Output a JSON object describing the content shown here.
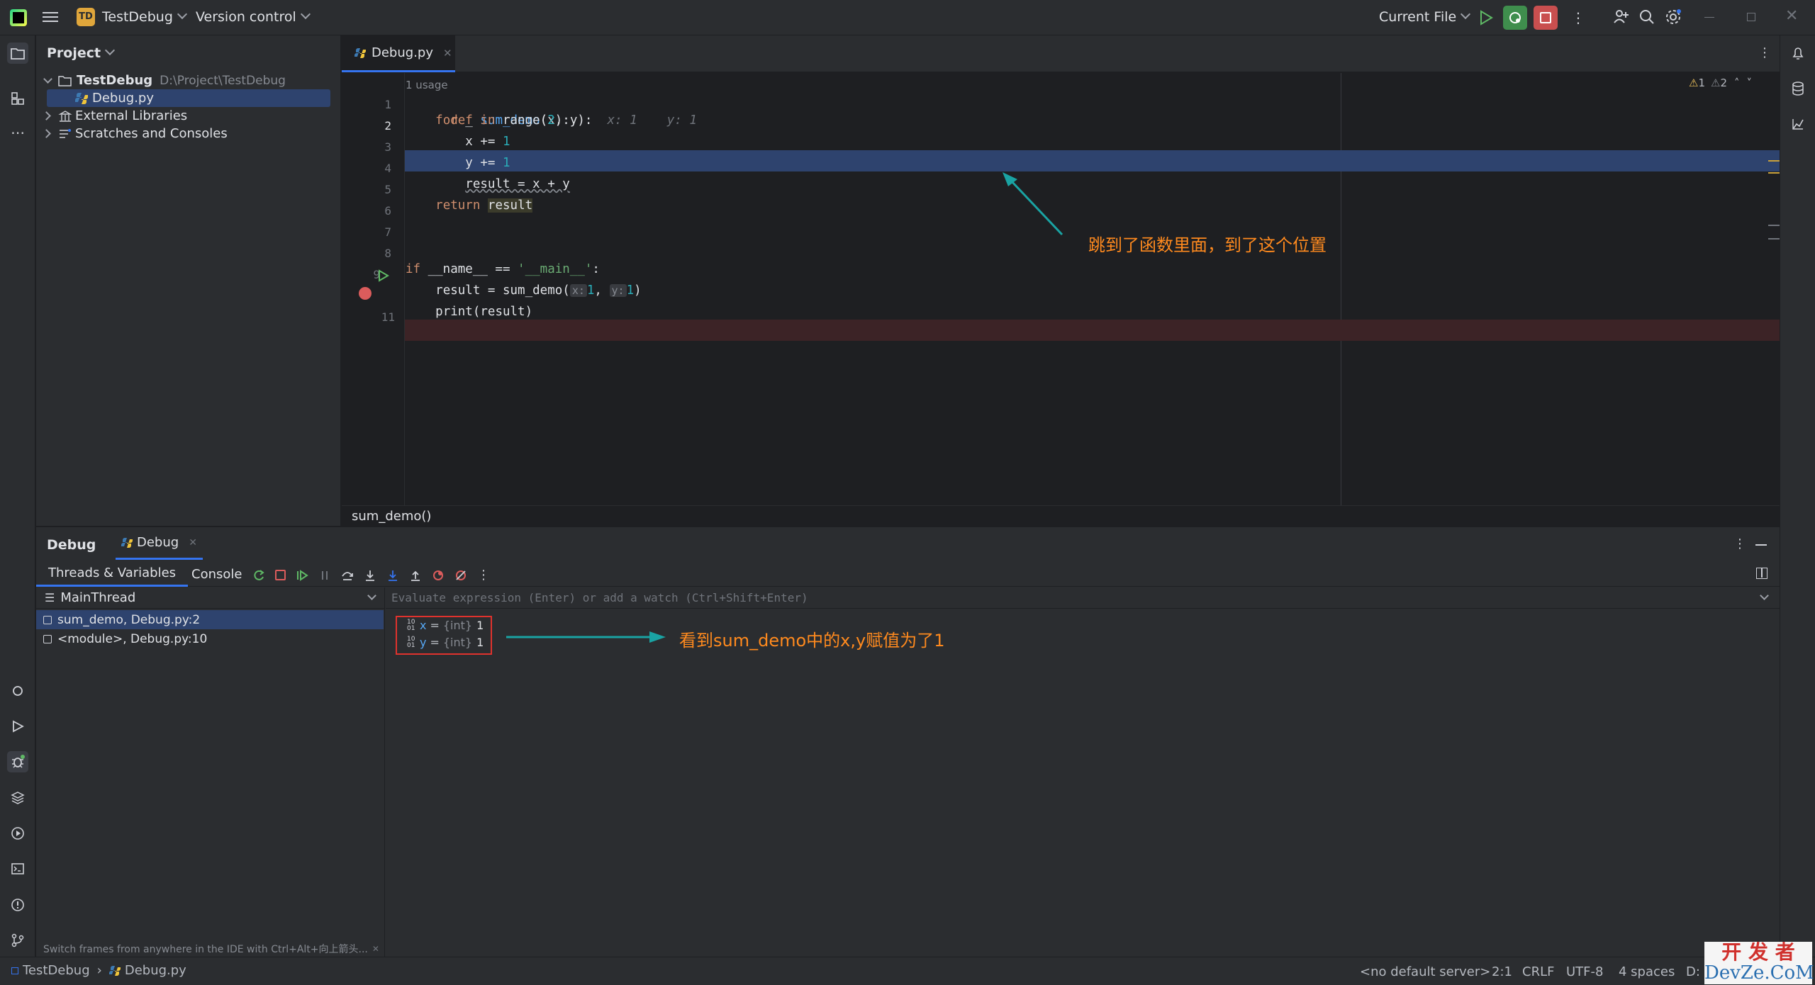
{
  "titlebar": {
    "project_badge": "TD",
    "project_name": "TestDebug",
    "vcs_label": "Version control",
    "run_config": "Current File"
  },
  "project_panel": {
    "title": "Project",
    "root_name": "TestDebug",
    "root_path": "D:\\Project\\TestDebug",
    "items": [
      {
        "label": "Debug.py"
      },
      {
        "label": "External Libraries"
      },
      {
        "label": "Scratches and Consoles"
      }
    ]
  },
  "editor": {
    "tab_label": "Debug.py",
    "usage_hint": "1 usage",
    "warnings": "1",
    "weak_warnings": "2",
    "breadcrumb": "sum_demo()",
    "lines": {
      "l1_def": "def ",
      "l1_fn": "sum_demo",
      "l1_rest": "(x, y):",
      "l1_hint": "x: 1    y: 1",
      "l2_for": "for",
      "l2_mid": " _ ",
      "l2_in": "in",
      "l2_range": " range(",
      "l2_num": "2",
      "l2_end": "):",
      "l3": "x += ",
      "l3_num": "1",
      "l4": "y += ",
      "l4_num": "1",
      "l5": "result = x + y",
      "l6_kw": "return ",
      "l6_var": "result",
      "l9_if": "if",
      "l9_mid": " __name__ == ",
      "l9_str": "'__main__'",
      "l9_end": ":",
      "l10_a": "result = sum_demo(",
      "l10_x": "x:",
      "l10_xv": "1",
      "l10_comma": ", ",
      "l10_y": "y:",
      "l10_yv": "1",
      "l10_end": ")",
      "l11": "print(result)"
    },
    "line_numbers": [
      "1",
      "2",
      "3",
      "4",
      "5",
      "6",
      "7",
      "8",
      "9",
      "10",
      "11"
    ],
    "annotation": "跳到了函数里面，到了这个位置"
  },
  "debug_panel": {
    "title": "Debug",
    "tab_label": "Debug",
    "subtabs": [
      "Threads & Variables",
      "Console"
    ],
    "thread": "MainThread",
    "frames": [
      "sum_demo, Debug.py:2",
      "<module>, Debug.py:10"
    ],
    "eval_placeholder": "Evaluate expression (Enter) or add a watch (Ctrl+Shift+Enter)",
    "variables": [
      {
        "name": "x",
        "type": "{int}",
        "value": "1"
      },
      {
        "name": "y",
        "type": "{int}",
        "value": "1"
      }
    ],
    "hint": "Switch frames from anywhere in the IDE with Ctrl+Alt+向上箭头...",
    "annotation": "看到sum_demo中的x,y赋值为了1"
  },
  "statusbar": {
    "crumb_project": "TestDebug",
    "crumb_file": "Debug.py",
    "server": "<no default server>",
    "position": "2:1",
    "line_sep": "CRLF",
    "encoding": "UTF-8",
    "indent": "4 spaces",
    "interp": "D:",
    "watermark_top": "开 发 者",
    "watermark_bottom": "DevZe.CoM"
  },
  "colors": {
    "accent_blue": "#2e436e",
    "breakpoint": "#db5c5c",
    "annotation": "#ff8a1e",
    "arrow": "#1aa3a3"
  }
}
